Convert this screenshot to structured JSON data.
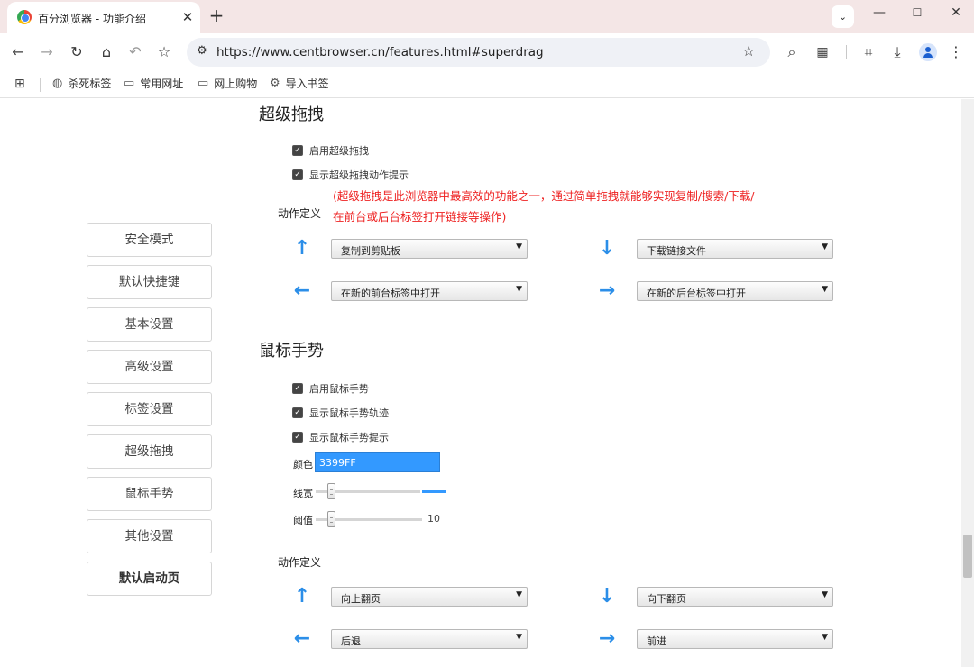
{
  "browser": {
    "tab_title": "百分浏览器 - 功能介绍",
    "url": "https://www.centbrowser.cn/features.html#superdrag",
    "bookmarks": [
      {
        "label": "杀死标签",
        "icon": "globe-icon"
      },
      {
        "label": "常用网址",
        "icon": "folder-icon"
      },
      {
        "label": "网上购物",
        "icon": "folder-icon"
      },
      {
        "label": "导入书签",
        "icon": "gear-icon"
      }
    ]
  },
  "sidebar": {
    "items": [
      {
        "label": "安全模式"
      },
      {
        "label": "默认快捷键"
      },
      {
        "label": "基本设置"
      },
      {
        "label": "高级设置"
      },
      {
        "label": "标签设置"
      },
      {
        "label": "超级拖拽"
      },
      {
        "label": "鼠标手势"
      },
      {
        "label": "其他设置"
      },
      {
        "label": "默认启动页"
      }
    ]
  },
  "superdrag": {
    "title": "超级拖拽",
    "checkboxes": [
      {
        "label": "启用超级拖拽",
        "checked": true
      },
      {
        "label": "显示超级拖拽动作提示",
        "checked": true
      }
    ],
    "note_line1": "(超级拖拽是此浏览器中最高效的功能之一，通过简单拖拽就能够实现复制/搜索/下载/",
    "note_line2": "在前台或后台标签打开链接等操作)",
    "actions_label": "动作定义",
    "actions": {
      "up": "复制到剪贴板",
      "down": "下载链接文件",
      "left": "在新的前台标签中打开",
      "right": "在新的后台标签中打开"
    }
  },
  "gesture": {
    "title": "鼠标手势",
    "checkboxes": [
      {
        "label": "启用鼠标手势",
        "checked": true
      },
      {
        "label": "显示鼠标手势轨迹",
        "checked": true
      },
      {
        "label": "显示鼠标手势提示",
        "checked": true
      }
    ],
    "color_label": "颜色",
    "color_value": "3399FF",
    "width_label": "线宽",
    "threshold_label": "阈值",
    "threshold_value": "10",
    "actions_label": "动作定义",
    "actions": {
      "up": "向上翻页",
      "down": "向下翻页",
      "left": "后退",
      "right": "前进"
    }
  },
  "colors": {
    "accent": "#3399FF",
    "note": "#EE2222",
    "arrow": "#2B8EE8"
  }
}
